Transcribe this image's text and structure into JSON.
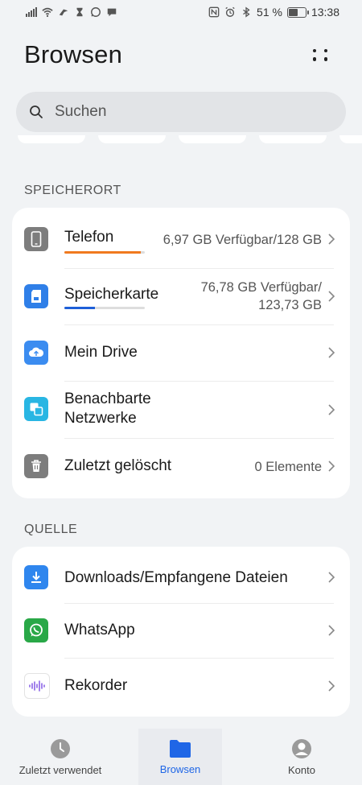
{
  "status_bar": {
    "battery_percent": "51 %",
    "time": "13:38",
    "icons": [
      "signal-icon",
      "wifi-icon",
      "bird-icon",
      "hourglass-icon",
      "whatsapp-icon",
      "chat-icon",
      "nfc-icon",
      "alarm-icon",
      "bluetooth-icon",
      "battery-icon"
    ]
  },
  "header": {
    "title": "Browsen",
    "more_icon": "more-dots-icon"
  },
  "search": {
    "placeholder": "Suchen"
  },
  "sections": {
    "storage": {
      "label": "SPEICHERORT",
      "items": [
        {
          "name": "Telefon",
          "detail": "6,97 GB Verfügbar/128 GB",
          "icon": "phone-icon",
          "progress": 0.95,
          "progress_color": "#f07a1f"
        },
        {
          "name": "Speicherkarte",
          "detail_line1": "76,78 GB Verfügbar/",
          "detail_line2": "123,73 GB",
          "icon": "sd-card-icon",
          "progress": 0.38,
          "progress_color": "#1e5fd8"
        },
        {
          "name": "Mein Drive",
          "detail": "",
          "icon": "cloud-drive-icon"
        },
        {
          "name_line1": "Benachbarte",
          "name_line2": "Netzwerke",
          "icon": "network-icon"
        },
        {
          "name": "Zuletzt gelöscht",
          "detail": "0 Elemente",
          "icon": "trash-icon"
        }
      ]
    },
    "source": {
      "label": "QUELLE",
      "items": [
        {
          "name": "Downloads/Empfangene Dateien",
          "icon": "download-icon"
        },
        {
          "name": "WhatsApp",
          "icon": "whatsapp-icon"
        },
        {
          "name": "Rekorder",
          "icon": "recorder-icon"
        }
      ]
    }
  },
  "bottom_nav": {
    "items": [
      {
        "label": "Zuletzt verwendet",
        "icon": "clock-icon",
        "active": false
      },
      {
        "label": "Browsen",
        "icon": "folder-icon",
        "active": true
      },
      {
        "label": "Konto",
        "icon": "account-icon",
        "active": false
      }
    ]
  },
  "colors": {
    "accent": "#1f66e6",
    "background": "#f1f3f5"
  }
}
